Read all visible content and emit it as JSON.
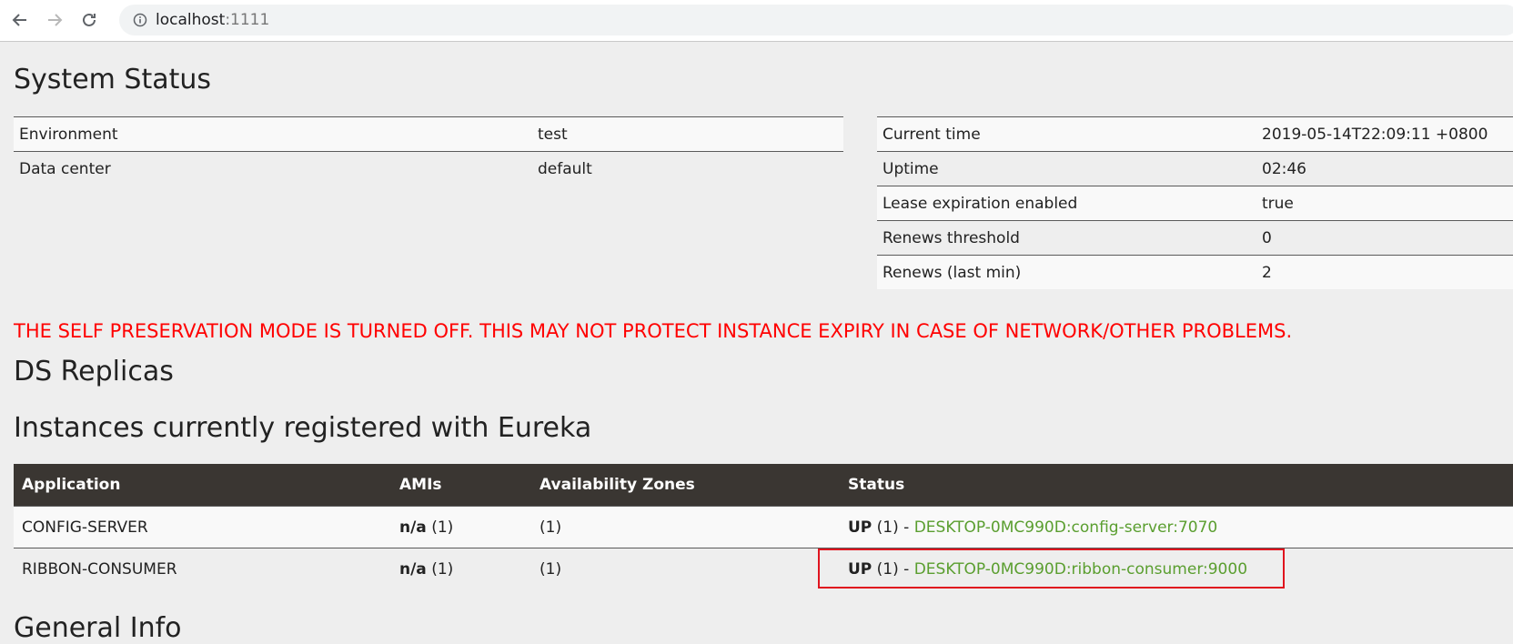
{
  "browser": {
    "back_icon": "back-arrow-icon",
    "forward_icon": "forward-arrow-icon",
    "reload_icon": "reload-icon",
    "info_icon": "info-icon",
    "url_host": "localhost",
    "url_port": ":1111"
  },
  "system_status": {
    "title": "System Status",
    "environment_rows": [
      {
        "label": "Environment",
        "value": "test"
      },
      {
        "label": "Data center",
        "value": "default"
      }
    ],
    "status_rows": [
      {
        "label": "Current time",
        "value": "2019-05-14T22:09:11 +0800"
      },
      {
        "label": "Uptime",
        "value": "02:46"
      },
      {
        "label": "Lease expiration enabled",
        "value": "true"
      },
      {
        "label": "Renews threshold",
        "value": "0"
      },
      {
        "label": "Renews (last min)",
        "value": "2"
      }
    ]
  },
  "warning": "THE SELF PRESERVATION MODE IS TURNED OFF. THIS MAY NOT PROTECT INSTANCE EXPIRY IN CASE OF NETWORK/OTHER PROBLEMS.",
  "ds_replicas": {
    "title": "DS Replicas"
  },
  "instances": {
    "title": "Instances currently registered with Eureka",
    "columns": [
      "Application",
      "AMIs",
      "Availability Zones",
      "Status"
    ],
    "rows": [
      {
        "application": "CONFIG-SERVER",
        "amis_bold": "n/a",
        "amis_count": " (1)",
        "zones": "(1)",
        "status_bold": "UP",
        "status_count": " (1) - ",
        "instance": "DESKTOP-0MC990D:config-server:7070"
      },
      {
        "application": "RIBBON-CONSUMER",
        "amis_bold": "n/a",
        "amis_count": " (1)",
        "zones": "(1)",
        "status_bold": "UP",
        "status_count": " (1) - ",
        "instance": "DESKTOP-0MC990D:ribbon-consumer:9000"
      }
    ]
  },
  "general_info": {
    "title": "General Info"
  },
  "colors": {
    "warning": "#ff0000",
    "table_header_bg": "#3a3632",
    "instance_link": "#5a9e2f",
    "highlight_box": "#e0141e"
  }
}
